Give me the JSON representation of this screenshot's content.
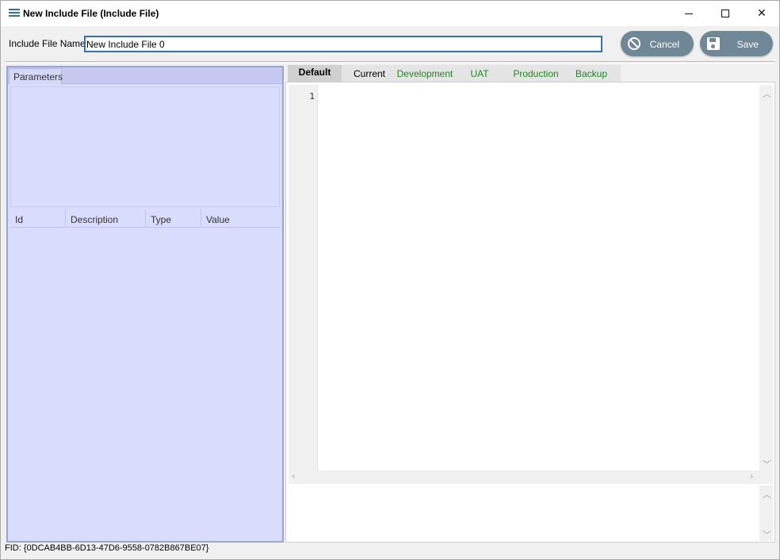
{
  "window": {
    "title": "New Include File (Include File)",
    "minimize_glyph": "",
    "maximize_glyph": "",
    "close_glyph": "✕"
  },
  "header": {
    "name_label": "Include File Name",
    "name_value": "New Include File 0",
    "cancel_label": "Cancel",
    "save_label": "Save"
  },
  "left_panel": {
    "tab_label": "Parameters",
    "columns": [
      "Id",
      "Description",
      "Type",
      "Value"
    ],
    "rows": []
  },
  "editor": {
    "tabs": [
      {
        "label": "Default",
        "active": true,
        "color": "#000000"
      },
      {
        "label": "Current",
        "active": false,
        "color": "#000000"
      },
      {
        "label": "Development",
        "active": false,
        "color": "#1a8a1a"
      },
      {
        "label": "UAT",
        "active": false,
        "color": "#1a8a1a"
      },
      {
        "label": "Production",
        "active": false,
        "color": "#1a8a1a"
      },
      {
        "label": "Backup",
        "active": false,
        "color": "#1a8a1a"
      }
    ],
    "line_numbers": [
      "1"
    ],
    "code": ""
  },
  "status": {
    "fid": "FID: {0DCAB4BB-6D13-47D6-9558-0782B867BE07}"
  },
  "colors": {
    "accent": "#2d6fcc",
    "button": "#6f8796",
    "panel": "#dadcfc"
  }
}
